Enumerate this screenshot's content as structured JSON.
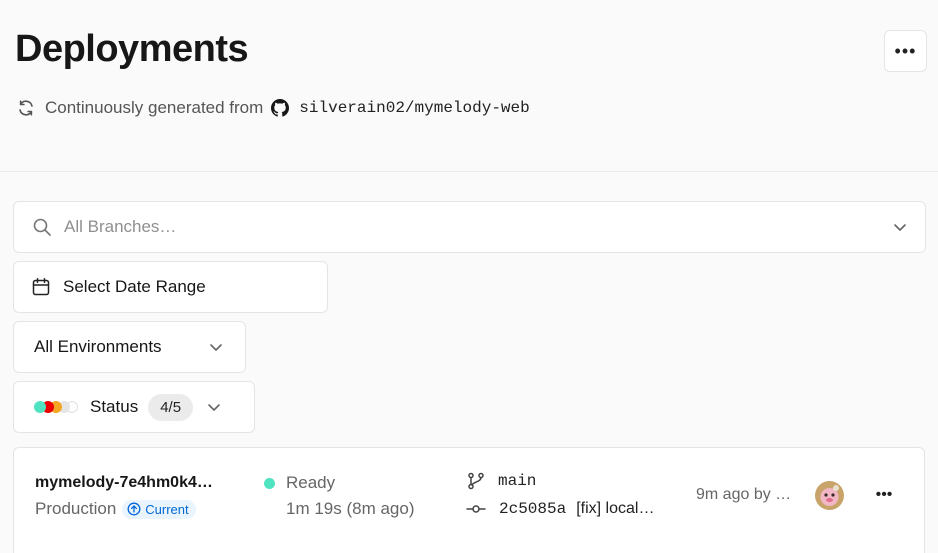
{
  "header": {
    "title": "Deployments",
    "menu_label": "•••",
    "subtitle_prefix": "Continuously generated from",
    "repo": "silverain02/mymelody-web"
  },
  "filters": {
    "search_placeholder": "All Branches…",
    "date_range_label": "Select Date Range",
    "environment_label": "All Environments",
    "status_label": "Status",
    "status_count": "4/5",
    "status_colors": [
      "#50e3c2",
      "#ee0000",
      "#f5a623",
      "#e5e5e5",
      "#ffffff"
    ]
  },
  "deployments": [
    {
      "name": "mymelody-7e4hm0k4…",
      "environment": "Production",
      "badge": "Current",
      "state": "Ready",
      "state_color": "#50e3c2",
      "duration": "1m 19s (8m ago)",
      "branch": "main",
      "commit_hash": "2c5085a",
      "commit_message": "[fix] local…",
      "time": "9m ago by …",
      "menu_label": "•••"
    }
  ]
}
